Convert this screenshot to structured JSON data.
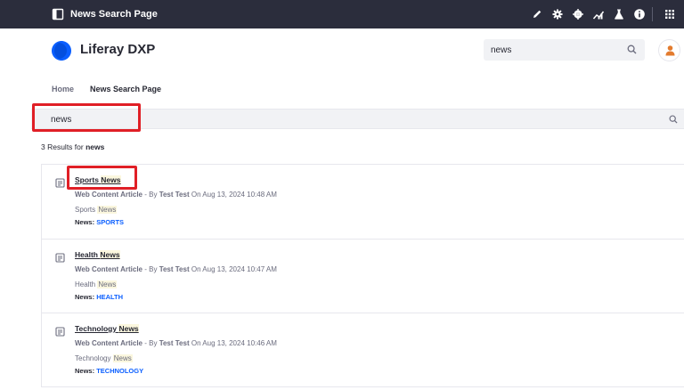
{
  "control_bar": {
    "title": "News Search Page",
    "icons": [
      "sidebar-toggle-icon",
      "pencil-icon",
      "gear-icon",
      "simulation-icon",
      "analytics-icon",
      "flask-icon",
      "info-icon",
      "apps-grid-icon"
    ],
    "background": "#2b2d3c"
  },
  "header": {
    "site_name": "Liferay DXP",
    "logo_color": "#0b5fff",
    "search": {
      "value": "news"
    },
    "avatar_color": "#e37b2e"
  },
  "nav": {
    "items": [
      {
        "label": "Home"
      },
      {
        "label": "News Search Page"
      }
    ]
  },
  "search": {
    "value": "news"
  },
  "result_summary": {
    "count_text": "3 Results for",
    "keyword": "news"
  },
  "results": [
    {
      "title_prefix": "Sports",
      "title_keyword": "News",
      "meta_type": "Web Content Article",
      "meta_by": " - By ",
      "meta_author": "Test Test",
      "meta_date": " On Aug 13, 2024 10:48 AM",
      "snippet_prefix": "Sports",
      "snippet_keyword": "News",
      "tag_label": "News:",
      "tag_value": "SPORTS"
    },
    {
      "title_prefix": "Health",
      "title_keyword": "News",
      "meta_type": "Web Content Article",
      "meta_by": " - By ",
      "meta_author": "Test Test",
      "meta_date": " On Aug 13, 2024 10:47 AM",
      "snippet_prefix": "Health",
      "snippet_keyword": "News",
      "tag_label": "News:",
      "tag_value": "HEALTH"
    },
    {
      "title_prefix": "Technology",
      "title_keyword": "News",
      "meta_type": "Web Content Article",
      "meta_by": " - By ",
      "meta_author": "Test Test",
      "meta_date": " On Aug 13, 2024 10:46 AM",
      "snippet_prefix": "Technology",
      "snippet_keyword": "News",
      "tag_label": "News:",
      "tag_value": "TECHNOLOGY"
    }
  ],
  "colors": {
    "accent": "#0b5fff",
    "highlight_box": "#e01f26",
    "keyword_highlight": "#fbf7de"
  }
}
